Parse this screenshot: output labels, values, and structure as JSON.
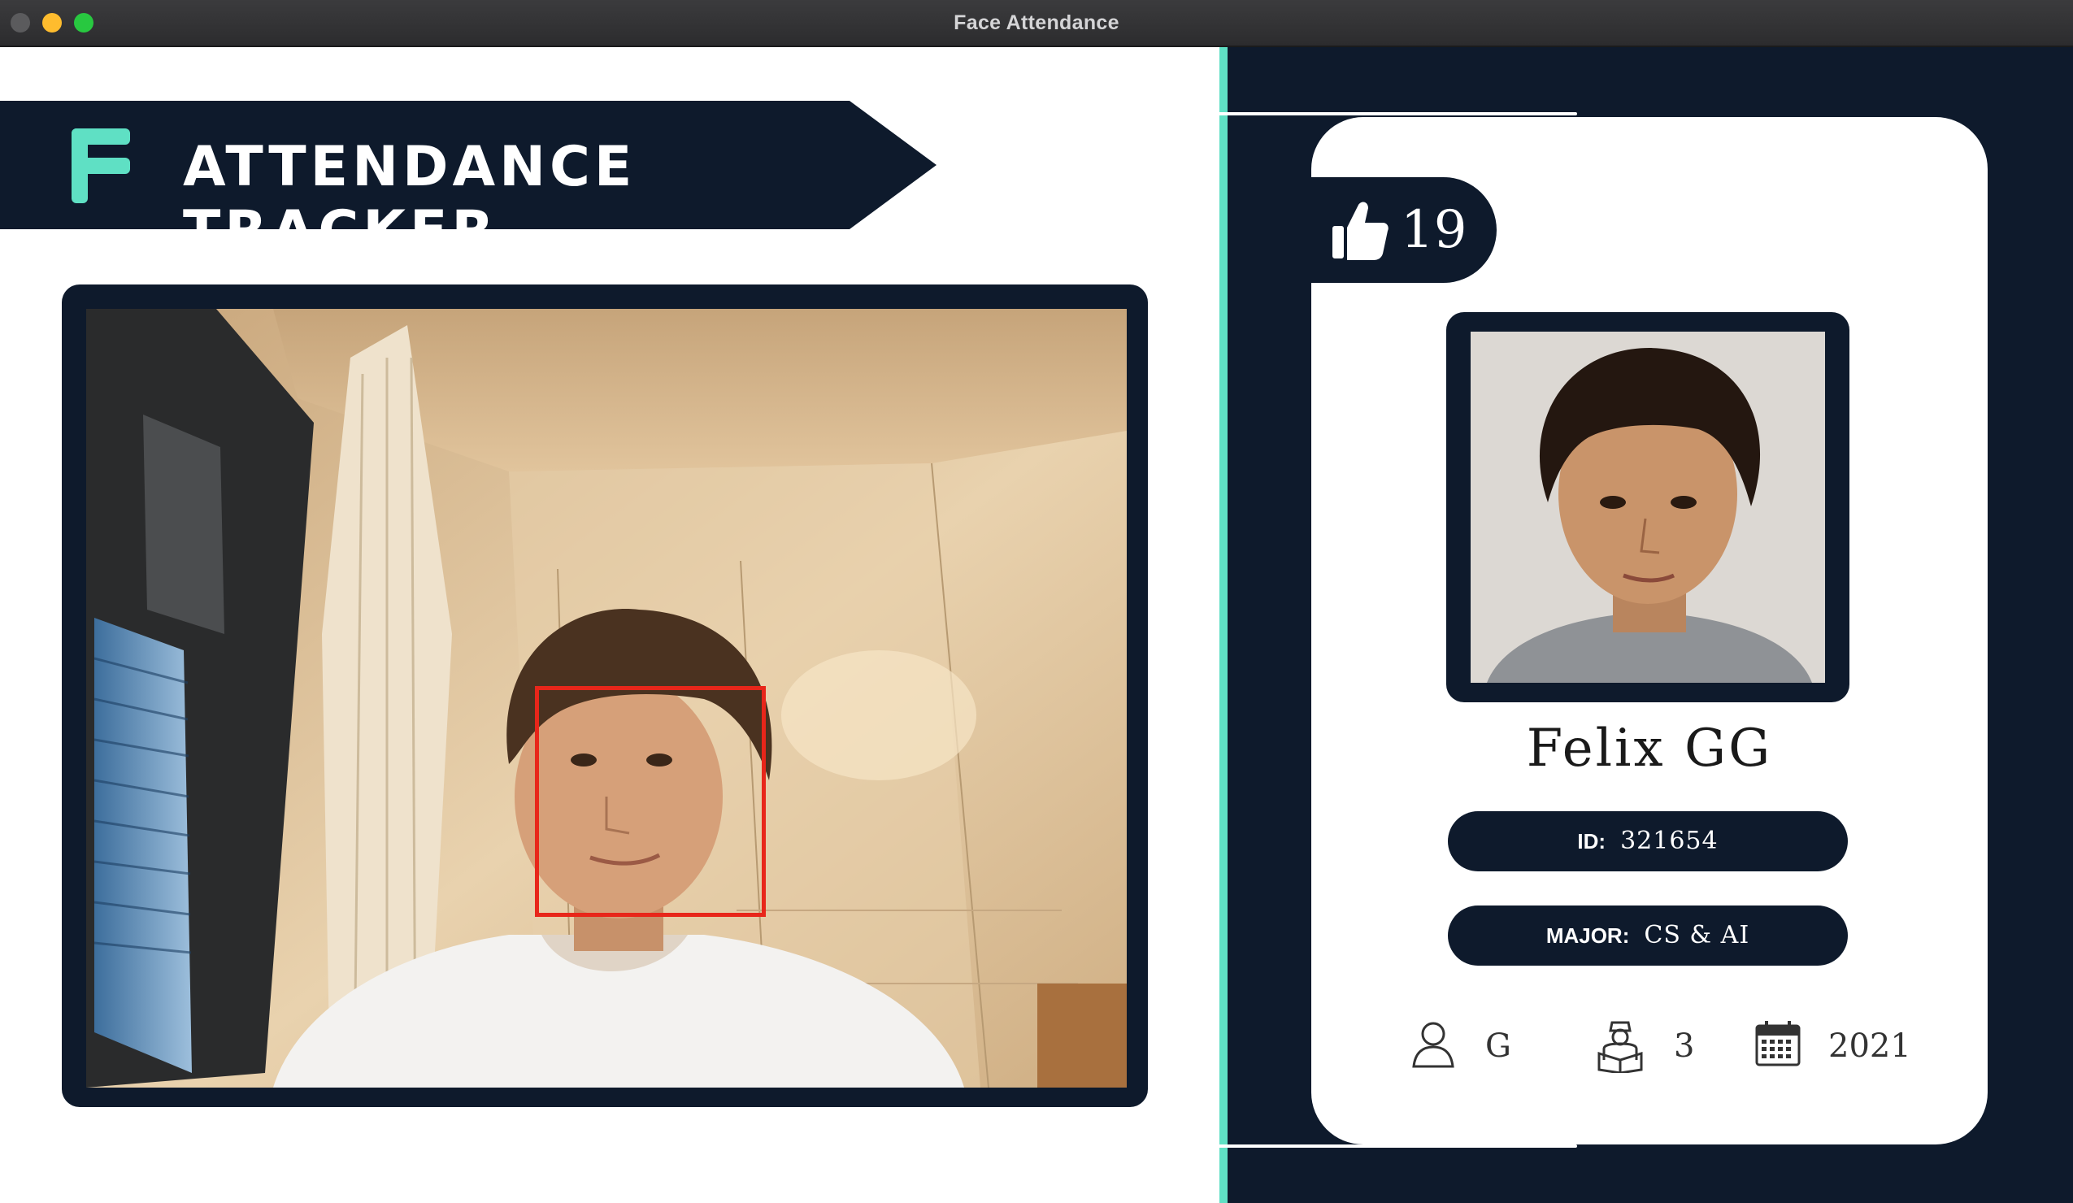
{
  "window": {
    "title": "Face Attendance"
  },
  "header": {
    "title": "ATTENDANCE TRACKER",
    "logo_icon": "f-logo-icon"
  },
  "camera": {
    "face_detection": "face-bounding-box"
  },
  "student": {
    "attendance_count": "19",
    "name": "Felix GG",
    "id_label": "ID:",
    "id_value": "321654",
    "major_label": "MAJOR:",
    "major_value": "CS & AI",
    "standing": "G",
    "year": "3",
    "starting_year": "2021"
  },
  "colors": {
    "navy": "#0e1a2c",
    "accent": "#5fe0c4",
    "detection": "#e8261a"
  }
}
